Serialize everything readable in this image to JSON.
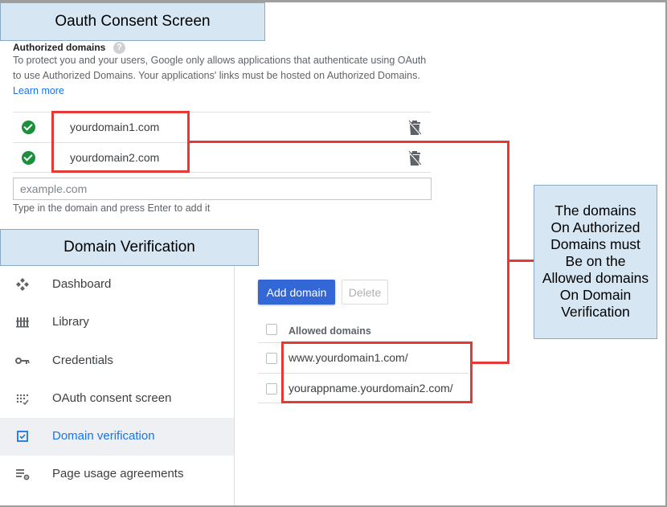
{
  "annotations": {
    "oauth_title": "Oauth Consent Screen",
    "domain_verification_title": "Domain Verification",
    "note_lines": [
      "The domains",
      "On Authorized",
      "Domains must",
      "Be on the",
      "Allowed domains",
      "On Domain",
      "Verification"
    ],
    "highlight_color": "#e53935"
  },
  "authorized_domains": {
    "label": "Authorized domains",
    "help_icon": "?",
    "description": "To protect you and your users, Google only allows applications that authenticate using OAuth to use Authorized Domains. Your applications' links must be hosted on Authorized Domains.",
    "learn_more": "Learn more",
    "domains": [
      {
        "name": "yourdomain1.com",
        "status_icon": "check-circle-icon",
        "action_icon": "delete-icon"
      },
      {
        "name": "yourdomain2.com",
        "status_icon": "check-circle-icon",
        "action_icon": "delete-icon"
      }
    ],
    "input_placeholder": "example.com",
    "input_hint": "Type in the domain and press Enter to add it"
  },
  "sidebar": {
    "items": [
      {
        "label": "Dashboard",
        "icon": "dashboard-icon"
      },
      {
        "label": "Library",
        "icon": "library-icon"
      },
      {
        "label": "Credentials",
        "icon": "key-icon"
      },
      {
        "label": "OAuth consent screen",
        "icon": "consent-icon"
      },
      {
        "label": "Domain verification",
        "icon": "verified-checkbox-icon",
        "active": true
      },
      {
        "label": "Page usage agreements",
        "icon": "settings-list-icon"
      }
    ]
  },
  "domain_verification": {
    "add_button": "Add domain",
    "delete_button": "Delete",
    "column_header": "Allowed domains",
    "domains": [
      "www.yourdomain1.com/",
      "yourappname.yourdomain2.com/"
    ]
  },
  "colors": {
    "primary": "#3367d6",
    "link": "#1a73e8",
    "success": "#1e8e3e",
    "callout_bg": "#d6e6f3"
  }
}
